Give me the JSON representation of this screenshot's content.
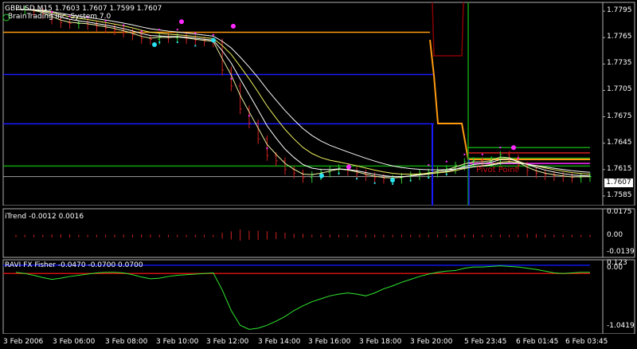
{
  "colors": {
    "frame": "#b0b0b0",
    "bull_bar": "#2bd02b",
    "bear_bar": "#d02020",
    "ma_yellow": "#f0f060",
    "ma_white": "#ffffff",
    "ma_light": "#e8f0a0",
    "pink": "#ff2aff",
    "cyan": "#29e0f0",
    "blue": "#1a1aff",
    "orange": "#ff9a10",
    "green": "#10a010",
    "darkred": "#8a0000",
    "gray": "#606060",
    "fisher_green": "#30e830",
    "fisher_red": "#d01010",
    "fisher_blue": "#0a10b0"
  },
  "main_pane": {
    "symbol_info": "GBPUSD,M15  1.7603 1.7607 1.7599 1.7607",
    "indicator_name": "BrainTrading Inc. System 7.0",
    "icon": "expert-smiley-icon",
    "current_price": "1.7607",
    "pivot_label": "Pivot Point",
    "y_ticks": [
      "1.7795",
      "1.7765",
      "1.7735",
      "1.7705",
      "1.7675",
      "1.7645",
      "1.7615",
      "1.7585"
    ]
  },
  "itrend_pane": {
    "label": "iTrend -0.0012 0.0016",
    "y_ticks": [
      "0.0175",
      "0.00",
      "-0.0139"
    ]
  },
  "fisher_pane": {
    "label": "RAVI FX Fisher -0.0470 -0.0700 0.0700",
    "y_ticks": [
      "0.123",
      "0.00",
      "-1.0419"
    ]
  },
  "x_axis": [
    "3 Feb 2006",
    "3 Feb 06:00",
    "3 Feb 08:00",
    "3 Feb 10:00",
    "3 Feb 12:00",
    "3 Feb 14:00",
    "3 Feb 16:00",
    "3 Feb 18:00",
    "3 Feb 20:00",
    "5 Feb 23:45",
    "6 Feb 01:45",
    "6 Feb 03:45"
  ],
  "chart_data": [
    {
      "type": "candlestick",
      "title": "GBPUSD,M15",
      "ylim": [
        1.7575,
        1.7805
      ],
      "x_labels": [
        "3 Feb 2006",
        "3 Feb 06:00",
        "3 Feb 08:00",
        "3 Feb 10:00",
        "3 Feb 12:00",
        "3 Feb 14:00",
        "3 Feb 16:00",
        "3 Feb 18:00",
        "3 Feb 20:00",
        "5 Feb 23:45",
        "6 Feb 01:45",
        "6 Feb 03:45"
      ],
      "last_bar": {
        "open": 1.7603,
        "high": 1.7607,
        "low": 1.7599,
        "close": 1.7607
      },
      "close_path": [
        1.7797,
        1.7797,
        1.7795,
        1.7792,
        1.7786,
        1.7782,
        1.7781,
        1.7781,
        1.778,
        1.7778,
        1.7776,
        1.7774,
        1.7771,
        1.7768,
        1.7764,
        1.7763,
        1.7766,
        1.7765,
        1.7766,
        1.7764,
        1.7762,
        1.7761,
        1.776,
        1.7728,
        1.771,
        1.7684,
        1.7668,
        1.765,
        1.7631,
        1.7625,
        1.7615,
        1.7611,
        1.7606,
        1.7609,
        1.7612,
        1.7615,
        1.7617,
        1.7614,
        1.7611,
        1.7608,
        1.7606,
        1.7605,
        1.7605,
        1.7607,
        1.7609,
        1.7611,
        1.7612,
        1.7614,
        1.7616,
        1.762,
        1.7624,
        1.7625,
        1.7624,
        1.7626,
        1.7632,
        1.7628,
        1.762,
        1.7614,
        1.7611,
        1.7609,
        1.7608,
        1.7607,
        1.7606,
        1.7607,
        1.7607
      ],
      "horizontal_levels": [
        {
          "value": 1.7771,
          "color": "orange"
        },
        {
          "value": 1.7723,
          "color": "blue"
        },
        {
          "value": 1.7667,
          "color": "blue"
        },
        {
          "value": 1.7619,
          "color": "green"
        },
        {
          "value": 1.7607,
          "color": "gray"
        },
        {
          "value": 1.764,
          "color": "green"
        },
        {
          "value": 1.7634,
          "color": "red"
        },
        {
          "value": 1.7628,
          "color": "green"
        },
        {
          "value": 1.7622,
          "color": "pink"
        }
      ]
    },
    {
      "type": "bar",
      "title": "iTrend",
      "ylim": [
        -0.0139,
        0.0175
      ],
      "values_shown": [
        -0.0012,
        0.0016
      ]
    },
    {
      "type": "line",
      "title": "RAVI FX Fisher",
      "ylim": [
        -1.0419,
        0.123
      ],
      "values_shown": [
        -0.047,
        -0.07,
        0.07
      ],
      "series": [
        {
          "values": [
            -0.05,
            -0.07,
            -0.1,
            -0.14,
            -0.17,
            -0.15,
            -0.12,
            -0.1,
            -0.08,
            -0.06,
            -0.05,
            -0.05,
            -0.06,
            -0.09,
            -0.13,
            -0.16,
            -0.15,
            -0.12,
            -0.1,
            -0.09,
            -0.08,
            -0.07,
            -0.06,
            -0.35,
            -0.7,
            -0.95,
            -1.02,
            -1.0,
            -0.95,
            -0.88,
            -0.8,
            -0.7,
            -0.62,
            -0.55,
            -0.5,
            -0.45,
            -0.42,
            -0.4,
            -0.42,
            -0.45,
            -0.4,
            -0.33,
            -0.28,
            -0.22,
            -0.17,
            -0.12,
            -0.08,
            -0.05,
            -0.03,
            -0.02,
            0.02,
            0.04,
            0.04,
            0.05,
            0.06,
            0.05,
            0.04,
            0.02,
            0.0,
            -0.03,
            -0.06,
            -0.07,
            -0.06,
            -0.05,
            -0.05
          ]
        }
      ]
    }
  ]
}
